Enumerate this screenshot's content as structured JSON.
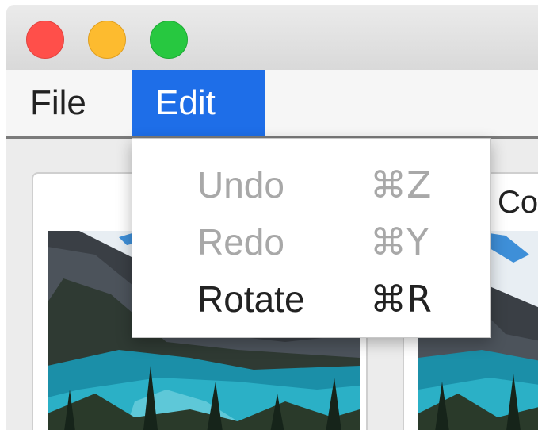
{
  "menubar": {
    "items": [
      {
        "label": "File"
      },
      {
        "label": "Edit"
      }
    ]
  },
  "edit_menu": {
    "items": [
      {
        "label": "Undo",
        "shortcut": "⌘Z",
        "enabled": false
      },
      {
        "label": "Redo",
        "shortcut": "⌘Y",
        "enabled": false
      },
      {
        "label": "Rotate",
        "shortcut": "⌘R",
        "enabled": true
      }
    ]
  },
  "content": {
    "right_panel_label": "Co"
  },
  "colors": {
    "menu_highlight": "#1e6ee8",
    "close_light": "#ff4f4a",
    "minimize_light": "#fdbb2f",
    "zoom_light": "#27c840",
    "disabled_text": "#a8a8a8"
  }
}
